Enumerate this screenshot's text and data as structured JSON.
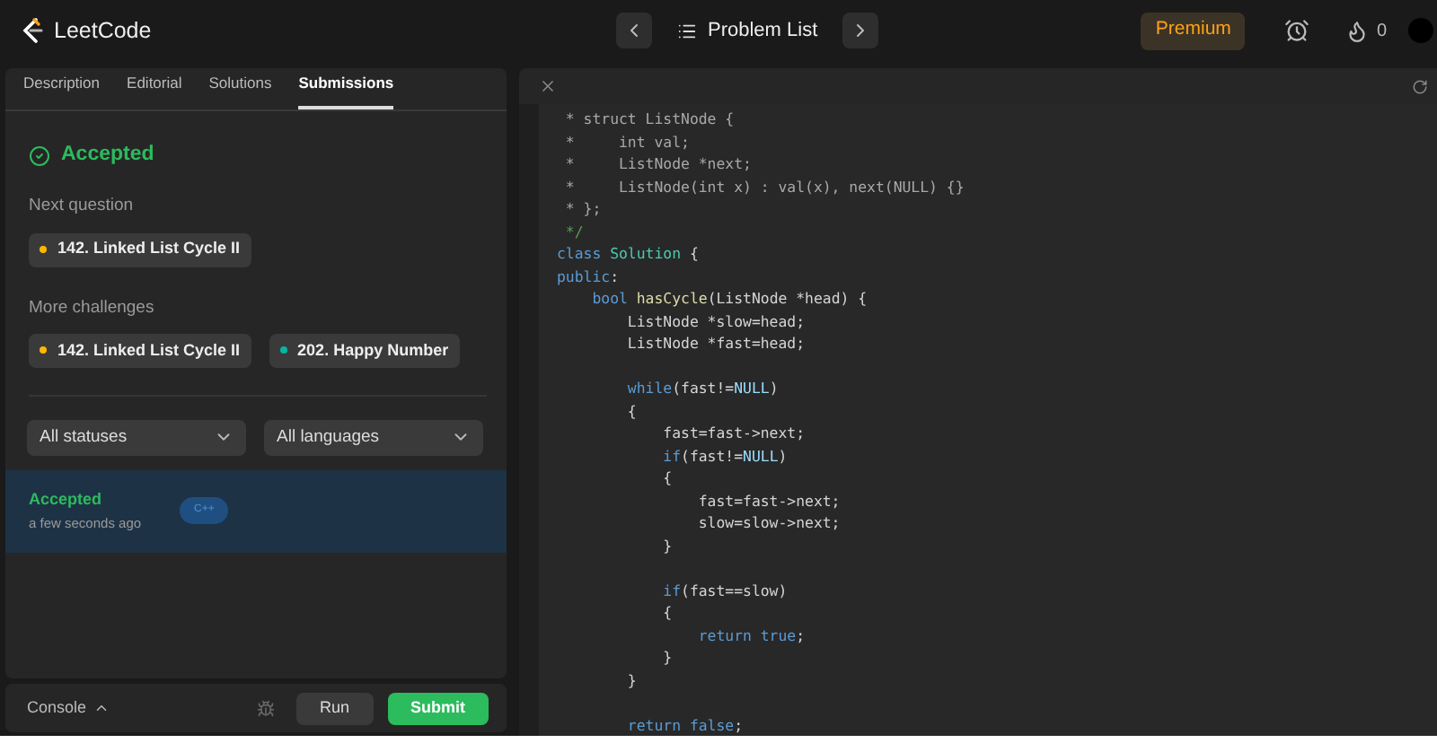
{
  "brand": "LeetCode",
  "nav": {
    "title": "Problem List"
  },
  "premium": "Premium",
  "streak": "0",
  "tabs": [
    {
      "label": "Description",
      "selected": false
    },
    {
      "label": "Editorial",
      "selected": false
    },
    {
      "label": "Solutions",
      "selected": false
    },
    {
      "label": "Submissions",
      "selected": true
    }
  ],
  "result": {
    "status": "Accepted"
  },
  "next_question": {
    "heading": "Next question",
    "items": [
      {
        "label": "142. Linked List Cycle II",
        "color": "#ffb800"
      }
    ]
  },
  "more_challenges": {
    "heading": "More challenges",
    "items": [
      {
        "label": "142. Linked List Cycle II",
        "color": "#ffb800"
      },
      {
        "label": "202. Happy Number",
        "color": "#00b8a3"
      }
    ]
  },
  "filters": [
    {
      "label": "All statuses"
    },
    {
      "label": "All languages"
    }
  ],
  "submissions": [
    {
      "status": "Accepted",
      "time": "a few seconds ago",
      "language": "C++",
      "selected": true
    }
  ],
  "console": {
    "label": "Console",
    "run": "Run",
    "submit": "Submit"
  },
  "editor": {
    "lines": [
      {
        "segments": [
          {
            "kind": "comment",
            "text": " * struct ListNode {"
          }
        ]
      },
      {
        "segments": [
          {
            "kind": "comment",
            "text": " *     int val;"
          }
        ]
      },
      {
        "segments": [
          {
            "kind": "comment",
            "text": " *     ListNode *next;"
          }
        ]
      },
      {
        "segments": [
          {
            "kind": "comment",
            "text": " *     ListNode(int x) : val(x), next(NULL) {}"
          }
        ]
      },
      {
        "segments": [
          {
            "kind": "comment",
            "text": " * };"
          }
        ]
      },
      {
        "segments": [
          {
            "kind": "comment_end",
            "text": " */"
          }
        ]
      },
      {
        "segments": [
          {
            "kind": "keyword",
            "text": "class "
          },
          {
            "kind": "type",
            "text": "Solution"
          },
          {
            "kind": "plain",
            "text": " {"
          }
        ]
      },
      {
        "segments": [
          {
            "kind": "keyword",
            "text": "public"
          },
          {
            "kind": "plain",
            "text": ":"
          }
        ]
      },
      {
        "segments": [
          {
            "kind": "keyword",
            "text": "    bool "
          },
          {
            "kind": "function",
            "text": "hasCycle"
          },
          {
            "kind": "plain",
            "text": "(ListNode *head) {"
          }
        ]
      },
      {
        "segments": [
          {
            "kind": "plain",
            "text": "        ListNode *slow=head;"
          }
        ]
      },
      {
        "segments": [
          {
            "kind": "plain",
            "text": "        ListNode *fast=head;"
          }
        ]
      },
      {
        "kind": "blank"
      },
      {
        "segments": [
          {
            "kind": "keyword",
            "text": "        while"
          },
          {
            "kind": "plain",
            "text": "(fast!="
          },
          {
            "kind": "constant",
            "text": "NULL"
          },
          {
            "kind": "plain",
            "text": ")"
          }
        ]
      },
      {
        "segments": [
          {
            "kind": "plain",
            "text": "        {"
          }
        ]
      },
      {
        "segments": [
          {
            "kind": "plain",
            "text": "            fast=fast->next;"
          }
        ]
      },
      {
        "segments": [
          {
            "kind": "keyword",
            "text": "            if"
          },
          {
            "kind": "plain",
            "text": "(fast!="
          },
          {
            "kind": "constant",
            "text": "NULL"
          },
          {
            "kind": "plain",
            "text": ")"
          }
        ]
      },
      {
        "segments": [
          {
            "kind": "plain",
            "text": "            {"
          }
        ]
      },
      {
        "segments": [
          {
            "kind": "plain",
            "text": "                fast=fast->next;"
          }
        ]
      },
      {
        "segments": [
          {
            "kind": "plain",
            "text": "                slow=slow->next;"
          }
        ]
      },
      {
        "segments": [
          {
            "kind": "plain",
            "text": "            }"
          }
        ]
      },
      {
        "kind": "blank"
      },
      {
        "segments": [
          {
            "kind": "keyword",
            "text": "            if"
          },
          {
            "kind": "plain",
            "text": "(fast==slow)"
          }
        ]
      },
      {
        "segments": [
          {
            "kind": "plain",
            "text": "            {"
          }
        ]
      },
      {
        "segments": [
          {
            "kind": "keyword",
            "text": "                return true"
          },
          {
            "kind": "plain",
            "text": ";"
          }
        ]
      },
      {
        "segments": [
          {
            "kind": "plain",
            "text": "            }"
          }
        ]
      },
      {
        "segments": [
          {
            "kind": "plain",
            "text": "        }"
          }
        ]
      },
      {
        "kind": "blank"
      },
      {
        "segments": [
          {
            "kind": "keyword",
            "text": "        return false"
          },
          {
            "kind": "plain",
            "text": ";"
          }
        ]
      }
    ]
  }
}
